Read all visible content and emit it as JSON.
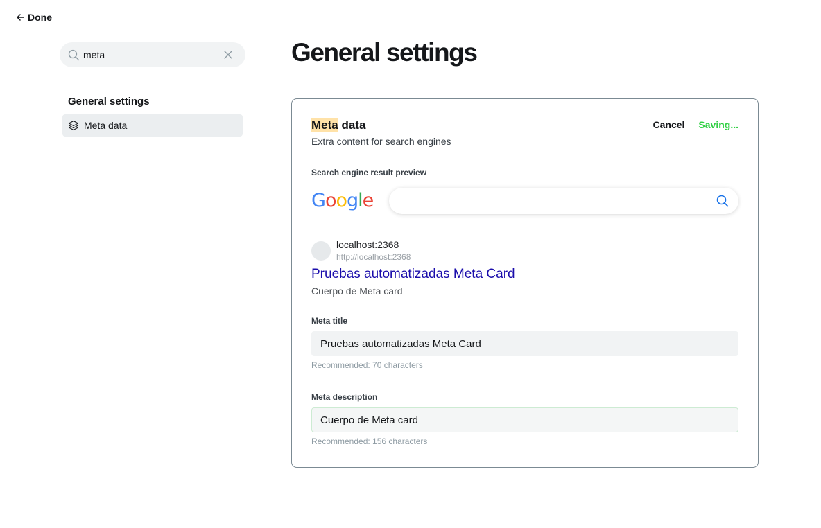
{
  "nav": {
    "done_label": "Done",
    "search_value": "meta",
    "section_title": "General settings",
    "items": [
      {
        "label": "Meta data",
        "icon": "layers-icon",
        "active": true
      }
    ]
  },
  "page": {
    "title": "General settings"
  },
  "card": {
    "title_highlight": "Meta",
    "title_rest": " data",
    "subtitle": "Extra content for search engines",
    "cancel_label": "Cancel",
    "saving_label": "Saving...",
    "preview_label": "Search engine result preview",
    "google": {
      "letters": [
        {
          "char": "G",
          "color": "#4285f4"
        },
        {
          "char": "o",
          "color": "#ea4335"
        },
        {
          "char": "o",
          "color": "#fbbc05"
        },
        {
          "char": "g",
          "color": "#4285f4"
        },
        {
          "char": "l",
          "color": "#34a853"
        },
        {
          "char": "e",
          "color": "#ea4335"
        }
      ]
    },
    "serp": {
      "site": "localhost:2368",
      "url": "http://localhost:2368",
      "title": "Pruebas automatizadas Meta Card",
      "description": "Cuerpo de Meta card"
    },
    "meta_title": {
      "label": "Meta title",
      "value": "Pruebas automatizadas Meta Card",
      "hint": "Recommended: 70 characters"
    },
    "meta_description": {
      "label": "Meta description",
      "value": "Cuerpo de Meta card",
      "hint": "Recommended: 156 characters"
    }
  },
  "colors": {
    "accent_green": "#30cf43",
    "highlight": "#ffe2a8",
    "serp_link": "#1a0dab"
  }
}
